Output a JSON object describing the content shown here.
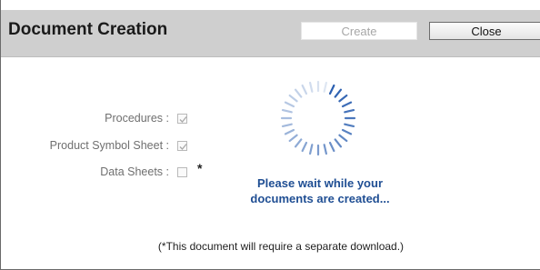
{
  "dialog": {
    "title": "Document Creation",
    "create_label": "Create",
    "close_label": "Close"
  },
  "options": [
    {
      "label": "Procedures :",
      "checked": true,
      "disabled": true
    },
    {
      "label": "Product Symbol Sheet :",
      "checked": true,
      "disabled": true
    },
    {
      "label": "Data Sheets :",
      "checked": false,
      "disabled": true
    }
  ],
  "asterisk": "*",
  "status": {
    "line1": "Please wait while your",
    "line2": "documents are created...",
    "icon": "loading-spinner-icon"
  },
  "footnote": "(*This document will require a separate download.)",
  "colors": {
    "status_text": "#1f4e93",
    "spinner": "#2b5fb0",
    "header_bg": "#cfcfcf"
  }
}
